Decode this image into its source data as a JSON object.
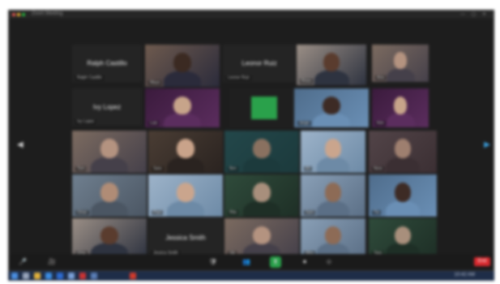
{
  "window": {
    "title": "Zoom Meeting",
    "controls": "—  ▢  ✕"
  },
  "colors": {
    "window_bg": "#1d1d1d",
    "end_red": "#d9282d",
    "taskbar": "#1e2d48",
    "active_speaker": "#2aa14b"
  },
  "name_tiles": [
    {
      "name": "Ralph Castillo",
      "caption": "Ralph Castillo"
    },
    {
      "name": "Leonor Ruiz",
      "caption": "Leonor Ruiz"
    },
    {
      "name": "Ivy Lopez",
      "caption": "Ivy Lopez"
    },
    {
      "name": "Jessica Smith",
      "caption": "Jessica Smith"
    }
  ],
  "video_captions": [
    "Maya",
    "Rosa",
    "Ana",
    "Luis",
    "Jorge",
    "Kim",
    "Tom",
    "Sara",
    "Ben",
    "Eli",
    "Nora",
    "Omar",
    "Paul",
    "Rita",
    "Sam",
    "Tia",
    "Uma",
    "Val",
    "Wes",
    "Yara",
    "Zoe",
    "Ivan"
  ],
  "toolbar": {
    "mute": "🎤",
    "video": "🎥",
    "security": "🛡",
    "participants": "👥",
    "chat": "💬",
    "share": "⬆",
    "record": "⏺",
    "reactions": "☺",
    "end_label": "End"
  },
  "taskbar": {
    "tray": "10:42 AM"
  },
  "nav": {
    "prev": "◀",
    "next": "▶"
  }
}
